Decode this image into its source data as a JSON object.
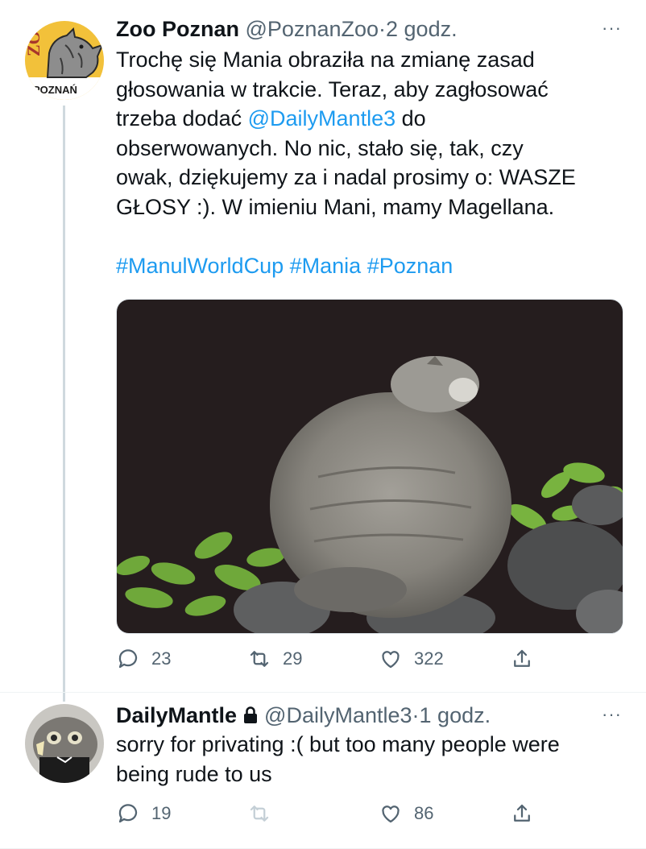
{
  "tweets": [
    {
      "name": "Zoo Poznan",
      "handle": "@PoznanZoo",
      "separator": "·",
      "time": "2 godz.",
      "more": "···",
      "text_lines": [
        "Trochę się Mania obraziła na zmianę zasad",
        "głosowania w trakcie. Teraz, aby zagłosować",
        "trzeba dodać",
        "@DailyMantle3",
        "do",
        "obserwowanych. No nic, stało się, tak, czy",
        "owak, dziękujemy za i nadal prosimy o: WASZE",
        "GŁOSY :). W imieniu Mani, mamy Magellana."
      ],
      "hashtags": [
        "#ManulWorldCup",
        "#Mania",
        "#Poznan"
      ],
      "avatar_text": {
        "zoo": "ZOO",
        "city": "POZNAŃ"
      },
      "replies": "23",
      "retweets": "29",
      "likes": "322"
    },
    {
      "name": "DailyMantle",
      "handle": "@DailyMantle3",
      "separator": "·",
      "time": "1 godz.",
      "more": "···",
      "text_lines": [
        "sorry for privating :( but too many people were",
        "being rude to us"
      ],
      "replies": "19",
      "likes": "86"
    }
  ],
  "colors": {
    "link": "#1d9bf0",
    "muted": "#536471",
    "line": "#cfd9de"
  },
  "icons": [
    "reply-icon",
    "retweet-icon",
    "like-icon",
    "share-icon",
    "lock-icon",
    "more-icon"
  ]
}
